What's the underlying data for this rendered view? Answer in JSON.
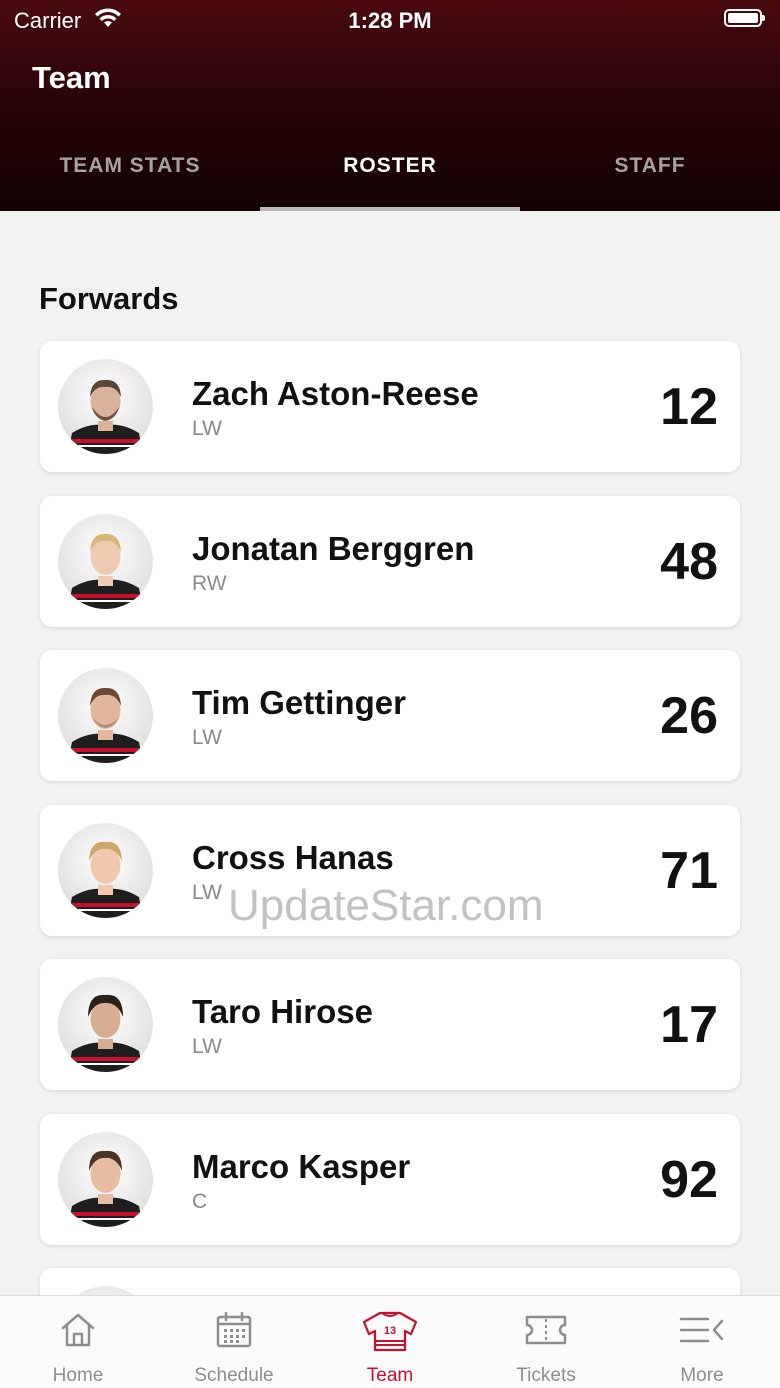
{
  "status_bar": {
    "carrier": "Carrier",
    "time": "1:28 PM"
  },
  "header": {
    "title": "Team"
  },
  "tabs": [
    {
      "label": "TEAM STATS",
      "active": false
    },
    {
      "label": "ROSTER",
      "active": true
    },
    {
      "label": "STAFF",
      "active": false
    }
  ],
  "section": {
    "title": "Forwards"
  },
  "players": [
    {
      "name": "Zach Aston-Reese",
      "position": "LW",
      "number": "12"
    },
    {
      "name": "Jonatan Berggren",
      "position": "RW",
      "number": "48"
    },
    {
      "name": "Tim Gettinger",
      "position": "LW",
      "number": "26"
    },
    {
      "name": "Cross Hanas",
      "position": "LW",
      "number": "71"
    },
    {
      "name": "Taro Hirose",
      "position": "LW",
      "number": "17"
    },
    {
      "name": "Marco Kasper",
      "position": "C",
      "number": "92"
    }
  ],
  "watermark": "UpdateStar.com",
  "bottom_nav": [
    {
      "label": "Home",
      "icon": "home-icon",
      "active": false
    },
    {
      "label": "Schedule",
      "icon": "calendar-icon",
      "active": false
    },
    {
      "label": "Team",
      "icon": "jersey-icon",
      "active": true,
      "jersey_number": "13"
    },
    {
      "label": "Tickets",
      "icon": "ticket-icon",
      "active": false
    },
    {
      "label": "More",
      "icon": "menu-icon",
      "active": false
    }
  ],
  "colors": {
    "accent": "#c8102e",
    "header_dark": "#140203",
    "header_top": "#4a0a0e",
    "inactive": "#8e8e8e"
  }
}
